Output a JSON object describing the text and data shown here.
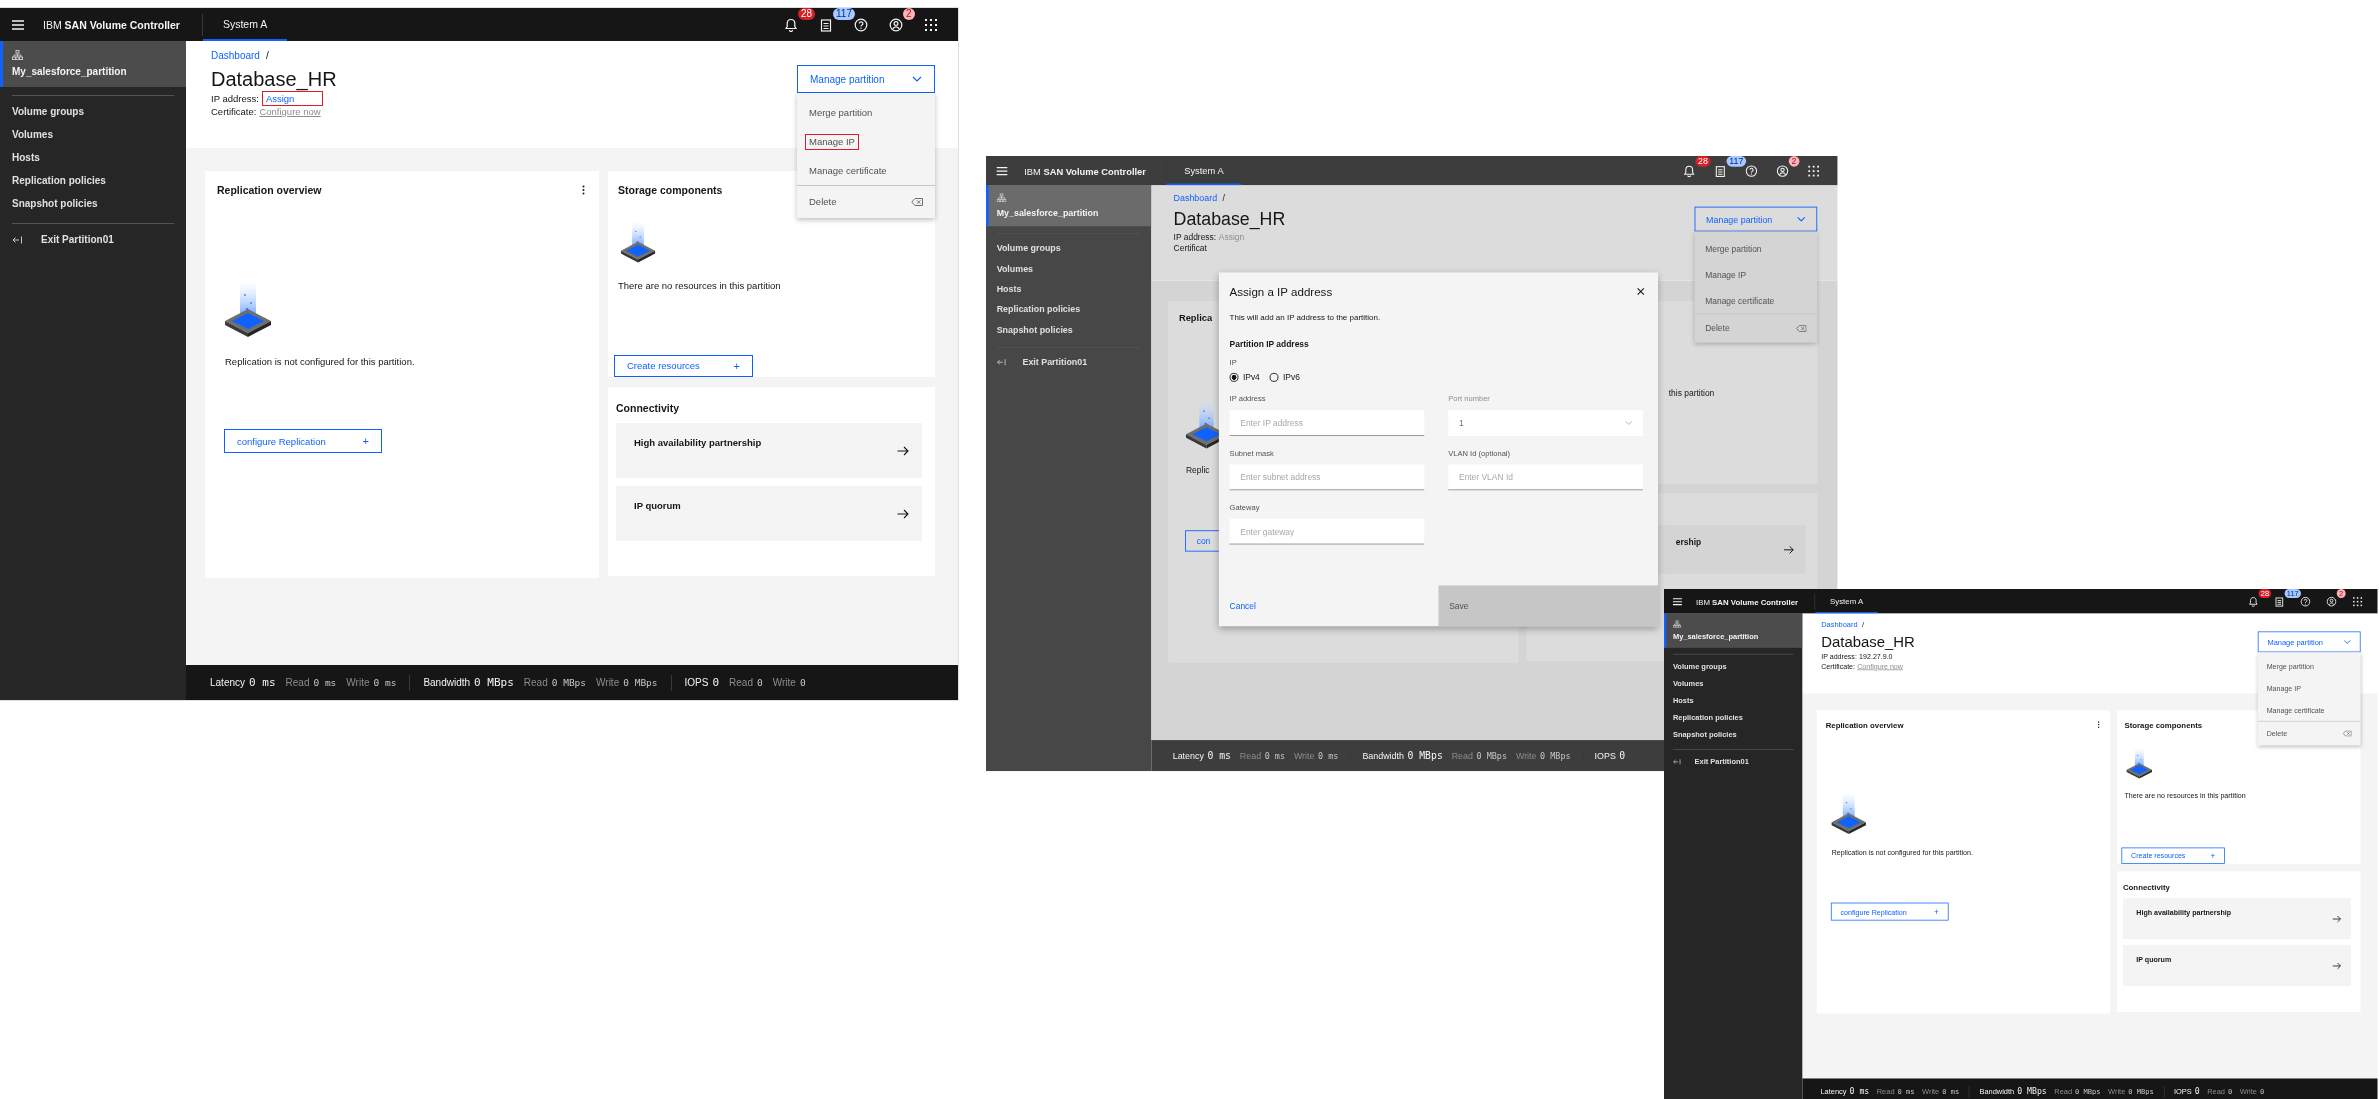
{
  "screens": [
    {
      "dimmed": false,
      "header": {
        "product": "IBM **SAN Volume Controller**",
        "tab": {
          "label": "System A",
          "selected": true
        },
        "actions": [
          {
            "kind": "notifications",
            "badge": "28",
            "color": "#da1e28"
          },
          {
            "kind": "tasks",
            "badge": "117",
            "color": "#a6c8ff"
          },
          {
            "kind": "help"
          },
          {
            "kind": "user",
            "badge": "2",
            "color": "#ffb3b8"
          },
          {
            "kind": "apps"
          }
        ]
      },
      "sidebar": {
        "partition": "My_salesforce_partition",
        "items": [
          "Volume groups",
          "Volumes",
          "Hosts",
          "Replication policies",
          "Snapshot policies"
        ],
        "exit": "Exit Partition01"
      },
      "breadcrumb": {
        "link": "Dashboard",
        "separator": "/"
      },
      "title": "Database_HR",
      "ip": {
        "label": "IP address:",
        "value": "Assign",
        "kind": "link",
        "annotated": true
      },
      "certificate": {
        "label": "Certificate:",
        "value": "Configure now"
      },
      "manage_button": "Manage partition",
      "menu": [
        {
          "label": "Merge partition",
          "kind": "action",
          "annotated": false
        },
        {
          "label": "Manage IP",
          "kind": "action",
          "annotated": true
        },
        {
          "label": "Manage certificate",
          "kind": "action",
          "annotated": false
        },
        {
          "label": "Delete",
          "kind": "delete",
          "annotated": false
        }
      ],
      "replication": {
        "title": "Replication overview",
        "message": "Replication is not configured for this partition.",
        "button": "configure Replication",
        "button_icon": "+"
      },
      "storage": {
        "title": "Storage components",
        "message": "There are no resources in this partition",
        "button": "Create resources",
        "button_icon": "+"
      },
      "connectivity": {
        "title": "Connectivity",
        "tiles": [
          {
            "label": "High availability partnership"
          },
          {
            "label": "IP quorum"
          }
        ]
      },
      "status_bar": [
        {
          "label": "Latency",
          "value": "0 ms",
          "details": [
            {
              "label": "Read",
              "value": "0 ms"
            },
            {
              "label": "Write",
              "value": "0 ms"
            }
          ]
        },
        {
          "label": "Bandwidth",
          "value": "0 MBps",
          "details": [
            {
              "label": "Read",
              "value": "0 MBps"
            },
            {
              "label": "Write",
              "value": "0 MBps"
            }
          ]
        },
        {
          "label": "IOPS",
          "value": "0",
          "details": [
            {
              "label": "Read",
              "value": "0"
            },
            {
              "label": "Write",
              "value": "0"
            }
          ]
        }
      ]
    },
    {
      "dimmed": true,
      "header": {
        "product": "IBM **SAN Volume Controller**",
        "tab": {
          "label": "System A",
          "selected": true
        },
        "actions": [
          {
            "kind": "notifications",
            "badge": "28",
            "color": "#da1e28"
          },
          {
            "kind": "tasks",
            "badge": "117",
            "color": "#a6c8ff"
          },
          {
            "kind": "help"
          },
          {
            "kind": "user",
            "badge": "2",
            "color": "#ffb3b8"
          },
          {
            "kind": "apps"
          }
        ]
      },
      "sidebar": {
        "partition": "My_salesforce_partition",
        "items": [
          "Volume groups",
          "Volumes",
          "Hosts",
          "Replication policies",
          "Snapshot policies"
        ],
        "exit": "Exit Partition01"
      },
      "breadcrumb": {
        "link": "Dashboard",
        "separator": "/"
      },
      "title": "Database_HR",
      "ip": {
        "label": "IP address:",
        "value": "Assign",
        "kind": "muted",
        "annotated": false
      },
      "certificate": {
        "label": "Certificat"
      },
      "manage_button": "Manage partition",
      "menu": [
        {
          "label": "Merge partition",
          "kind": "action",
          "annotated": false
        },
        {
          "label": "Manage IP",
          "kind": "action",
          "annotated": false
        },
        {
          "label": "Manage certificate",
          "kind": "action",
          "annotated": false
        },
        {
          "label": "Delete",
          "kind": "delete",
          "annotated": false
        }
      ],
      "replication": {
        "title": "Replica",
        "message": "Replic",
        "button": "con"
      },
      "storage": {
        "message": "this partition",
        "truncated_start": true
      },
      "connectivity": {
        "tiles": [
          {
            "label": "ership",
            "truncated_start": true
          }
        ]
      },
      "status_bar": [
        {
          "label": "Latency",
          "value": "0 ms",
          "details": [
            {
              "label": "Read",
              "value": "0 ms"
            },
            {
              "label": "Write",
              "value": "0 ms"
            }
          ]
        },
        {
          "label": "Bandwidth",
          "value": "0 MBps",
          "details": [
            {
              "label": "Read",
              "value": "0 MBps"
            },
            {
              "label": "Write",
              "value": "0 MBps"
            }
          ]
        },
        {
          "label": "IOPS",
          "value": "0"
        }
      ],
      "dialog": {
        "title": "Assign a IP address",
        "description": "This will add an IP address to the partition.",
        "section": "Partition IP address",
        "ip_label": "IP",
        "options": [
          {
            "label": "IPv4",
            "selected": true
          },
          {
            "label": "IPv6",
            "selected": false
          }
        ],
        "fields": [
          {
            "label": "IP address",
            "placeholder": "Enter IP address",
            "kind": "text",
            "disabled": false
          },
          {
            "label": "Port number",
            "value": "1",
            "kind": "select",
            "disabled": true
          },
          {
            "label": "Subnet mask",
            "placeholder": "Enter subnet address",
            "kind": "text",
            "disabled": false
          },
          {
            "label": "VLAN Id (optional)",
            "placeholder": "Enter VLAN Id",
            "kind": "text",
            "disabled": false
          },
          {
            "label": "Gateway",
            "placeholder": "Enter gateway",
            "kind": "text",
            "disabled": false
          }
        ],
        "cancel": "Cancel",
        "save": {
          "label": "Save",
          "disabled": true
        }
      }
    },
    {
      "dimmed": false,
      "header": {
        "product": "IBM **SAN Volume Controller**",
        "tab": {
          "label": "System A",
          "selected": true
        },
        "actions": [
          {
            "kind": "notifications",
            "badge": "28",
            "color": "#da1e28"
          },
          {
            "kind": "tasks",
            "badge": "117",
            "color": "#a6c8ff"
          },
          {
            "kind": "help"
          },
          {
            "kind": "user",
            "badge": "2",
            "color": "#ffb3b8"
          },
          {
            "kind": "apps"
          }
        ]
      },
      "sidebar": {
        "partition": "My_salesforce_partition",
        "items": [
          "Volume groups",
          "Volumes",
          "Hosts",
          "Replication policies",
          "Snapshot policies"
        ],
        "exit": "Exit Partition01"
      },
      "breadcrumb": {
        "link": "Dashboard",
        "separator": "/"
      },
      "title": "Database_HR",
      "ip": {
        "label": "IP address:",
        "value": "192.27.9.0",
        "kind": "plain",
        "annotated": false
      },
      "certificate": {
        "label": "Certificate:",
        "value": "Configure now"
      },
      "manage_button": "Manage partition",
      "menu": [
        {
          "label": "Merge partition",
          "kind": "action",
          "annotated": false
        },
        {
          "label": "Manage IP",
          "kind": "action",
          "annotated": false
        },
        {
          "label": "Manage certificate",
          "kind": "action",
          "annotated": false
        },
        {
          "label": "Delete",
          "kind": "delete",
          "annotated": false
        }
      ],
      "replication": {
        "title": "Replication overview",
        "message": "Replication is not configured for this partition.",
        "button": "configure Replication",
        "button_icon": "+"
      },
      "storage": {
        "title": "Storage components",
        "message": "There are no resources in this partition",
        "button": "Create resources",
        "button_icon": "+"
      },
      "connectivity": {
        "title": "Connectivity",
        "tiles": [
          {
            "label": "High availability partnership"
          },
          {
            "label": "IP quorum"
          }
        ]
      },
      "status_bar": [
        {
          "label": "Latency",
          "value": "0 ms",
          "details": [
            {
              "label": "Read",
              "value": "0 ms"
            },
            {
              "label": "Write",
              "value": "0 ms"
            }
          ]
        },
        {
          "label": "Bandwidth",
          "value": "0 MBps",
          "details": [
            {
              "label": "Read",
              "value": "0 MBps"
            },
            {
              "label": "Write",
              "value": "0 MBps"
            }
          ]
        },
        {
          "label": "IOPS",
          "value": "0",
          "details": [
            {
              "label": "Read",
              "value": "0"
            },
            {
              "label": "Write",
              "value": "0"
            }
          ]
        }
      ]
    }
  ]
}
